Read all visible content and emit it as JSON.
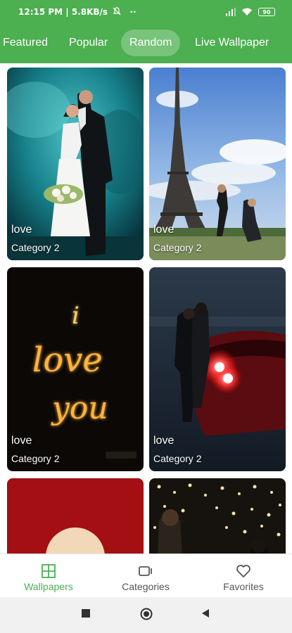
{
  "status": {
    "time_info": "12:15 PM | 5.8KB/s",
    "extra": "··",
    "battery": "90"
  },
  "tabs": [
    {
      "label": "Featured"
    },
    {
      "label": "Popular"
    },
    {
      "label": "Random",
      "active": true
    },
    {
      "label": "Live Wallpaper"
    }
  ],
  "cards": [
    {
      "title": "love",
      "category": "Category 2"
    },
    {
      "title": "love",
      "category": "Category 2"
    },
    {
      "title": "love",
      "category": "Category 2"
    },
    {
      "title": "love",
      "category": "Category 2"
    },
    {
      "title": "",
      "category": ""
    },
    {
      "title": "",
      "category": ""
    }
  ],
  "neon_text": {
    "line1": "i",
    "line2": "love",
    "line3": "you"
  },
  "bottom_nav": [
    {
      "label": "Wallpapers",
      "icon": "grid-icon",
      "active": true
    },
    {
      "label": "Categories",
      "icon": "categories-icon"
    },
    {
      "label": "Favorites",
      "icon": "heart-icon"
    }
  ],
  "colors": {
    "brand": "#4caf50",
    "active_nav": "#4caf50",
    "inactive_nav": "#555555"
  }
}
